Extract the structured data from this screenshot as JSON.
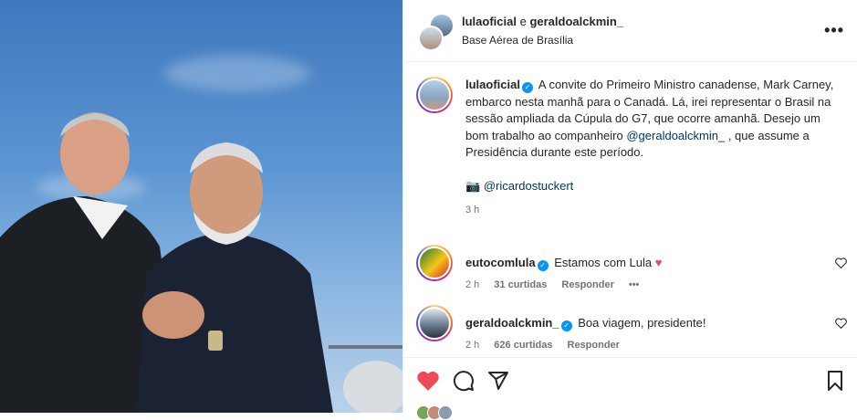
{
  "header": {
    "user1": "lulaoficial",
    "separator": " e ",
    "user2": "geraldoalckmin_",
    "location": "Base Aérea de Brasília",
    "more": "•••"
  },
  "caption": {
    "username": "lulaoficial",
    "text": "A convite do Primeiro Ministro canadense, Mark Carney, embarco nesta manhã para o Canadá. Lá, irei representar o Brasil na sessão ampliada da Cúpula do G7, que ocorre amanhã. Desejo um bom trabalho ao companheiro",
    "mention": "@geraldoalckmin_",
    "text_after": " , que assume a Presidência durante este período.",
    "camera": "📷",
    "credit": "@ricardostuckert",
    "time": "3 h"
  },
  "comments": [
    {
      "username": "eutocomlula",
      "text": "Estamos com Lula",
      "emoji": "♥",
      "time": "2 h",
      "likes": "31 curtidas",
      "reply": "Responder",
      "more": "•••"
    },
    {
      "username": "geraldoalckmin_",
      "text": "Boa viagem, presidente!",
      "time": "2 h",
      "likes": "626 curtidas",
      "reply": "Responder"
    }
  ],
  "colors": {
    "like_red": "#ed4956",
    "verified_blue": "#0095f6",
    "mention_blue": "#00376b"
  },
  "icons": [
    "heart-icon",
    "comment-icon",
    "share-icon",
    "bookmark-icon",
    "verified-icon",
    "camera-icon"
  ]
}
